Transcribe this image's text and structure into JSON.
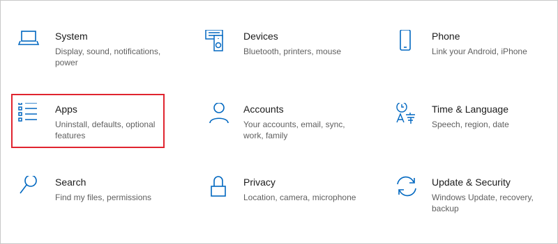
{
  "tiles": [
    {
      "title": "System",
      "description": "Display, sound, notifications, power",
      "icon": "laptop-icon"
    },
    {
      "title": "Devices",
      "description": "Bluetooth, printers, mouse",
      "icon": "devices-icon"
    },
    {
      "title": "Phone",
      "description": "Link your Android, iPhone",
      "icon": "phone-icon"
    },
    {
      "title": "Apps",
      "description": "Uninstall, defaults, optional features",
      "icon": "apps-list-icon"
    },
    {
      "title": "Accounts",
      "description": "Your accounts, email, sync, work, family",
      "icon": "person-icon"
    },
    {
      "title": "Time & Language",
      "description": "Speech, region, date",
      "icon": "time-language-icon"
    },
    {
      "title": "Search",
      "description": "Find my files, permissions",
      "icon": "search-icon"
    },
    {
      "title": "Privacy",
      "description": "Location, camera, microphone",
      "icon": "lock-icon"
    },
    {
      "title": "Update & Security",
      "description": "Windows Update, recovery, backup",
      "icon": "sync-arrows-icon"
    }
  ],
  "highlighted_tile": "Apps",
  "colors": {
    "accent": "#0067c0",
    "highlight": "#e0242f",
    "text": "#1b1b1b",
    "subtext": "#5f5f5f"
  }
}
